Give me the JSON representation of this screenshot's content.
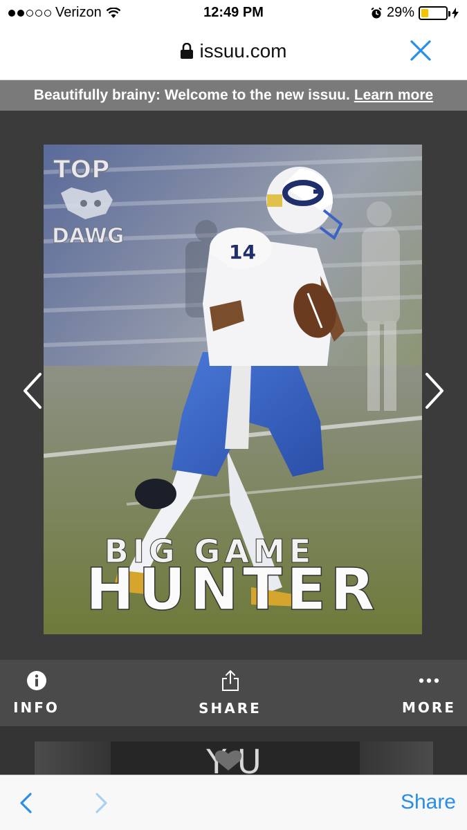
{
  "status": {
    "carrier": "Verizon",
    "time": "12:49 PM",
    "battery": "29%",
    "battery_level": 0.29,
    "battery_color": "#f5c400"
  },
  "browser": {
    "domain": "issuu.com",
    "accent": "#2a8ee6"
  },
  "banner": {
    "text": "Beautifully brainy: Welcome to the new issuu.",
    "link": "Learn more"
  },
  "cover": {
    "logo_top": "TOP",
    "logo_bottom": "DAWG",
    "headline_small": "BIG GAME",
    "headline_large": "HUNTER",
    "jersey_number": "14"
  },
  "actions": [
    {
      "label": "INFO",
      "icon": "info-icon"
    },
    {
      "label": "SHARE",
      "icon": "share-icon"
    },
    {
      "label": "MORE",
      "icon": "more-dots-icon"
    }
  ],
  "next_page": {
    "text": "Y  U"
  },
  "toolbar": {
    "share_label": "Share"
  }
}
